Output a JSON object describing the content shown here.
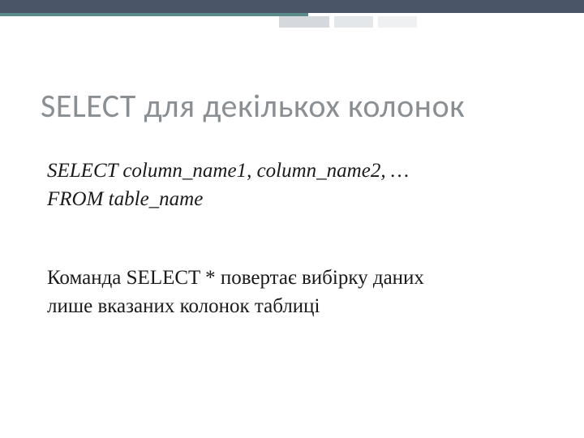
{
  "slide": {
    "title": "SELECT для декількох колонок",
    "syntax1": "SELECT column_name1, column_name2, …",
    "syntax2": "FROM table_name",
    "explanation1": "Команда SELECT * повертає вибірку даних",
    "explanation2": "лише вказаних колонок таблиці"
  }
}
